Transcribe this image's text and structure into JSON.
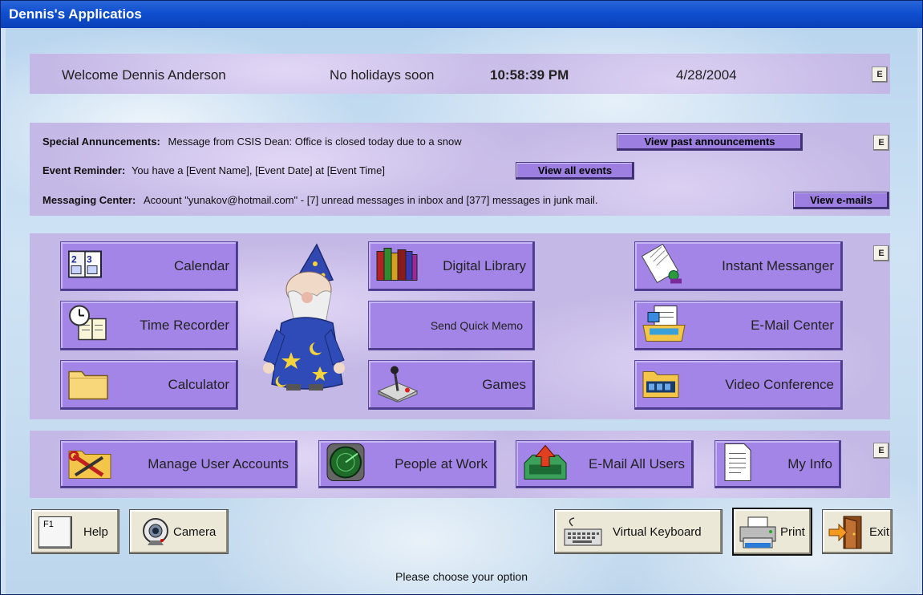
{
  "window": {
    "title": "Dennis's Applicatios"
  },
  "header": {
    "welcome": "Welcome Dennis Anderson",
    "holidays": "No holidays soon",
    "time": "10:58:39 PM",
    "date": "4/28/2004",
    "edit_label": "E"
  },
  "announcements": {
    "special_label": "Special Annuncements:",
    "special_text": "Message from CSIS Dean: Office is closed today due to a snow",
    "special_button": "View past announcements",
    "event_label": "Event Reminder:",
    "event_text": "You have a [Event Name], [Event Date] at [Event Time]",
    "event_button": "View all events",
    "messaging_label": "Messaging Center:",
    "messaging_text": "Acoount \"yunakov@hotmail.com\" - [7] unread messages in inbox and [377] messages in junk mail.",
    "messaging_button": "View e-mails",
    "edit_label": "E"
  },
  "apps": {
    "edit_label": "E",
    "calendar": "Calendar",
    "time_recorder": "Time Recorder",
    "calculator": "Calculator",
    "digital_library": "Digital Library",
    "send_quick_memo": "Send Quick Memo",
    "games": "Games",
    "instant_messanger": "Instant Messanger",
    "email_center": "E-Mail Center",
    "video_conference": "Video Conference"
  },
  "admin": {
    "edit_label": "E",
    "manage_users": "Manage User Accounts",
    "people_at_work": "People at Work",
    "email_all_users": "E-Mail All Users",
    "my_info": "My Info"
  },
  "toolbar": {
    "help": "Help",
    "help_key": "F1",
    "camera": "Camera",
    "virtual_keyboard": "Virtual Keyboard",
    "print": "Print",
    "exit": "Exit"
  },
  "status": {
    "text": "Please choose your option"
  },
  "icons": {
    "calendar": "calendar-icon",
    "time_recorder": "clock-book-icon",
    "calculator": "folder-icon",
    "digital_library": "books-icon",
    "games": "joystick-icon",
    "instant_messanger": "messenger-icon",
    "email_center": "mail-tray-icon",
    "video_conference": "film-folder-icon",
    "manage_users": "tools-folder-icon",
    "people_at_work": "radar-icon",
    "email_all_users": "outbox-icon",
    "my_info": "document-icon",
    "help": "f1-key-icon",
    "camera": "webcam-icon",
    "virtual_keyboard": "keyboard-icon",
    "print": "printer-icon",
    "exit": "exit-door-icon",
    "mascot": "wizard-mascot"
  },
  "colors": {
    "titlebar": "#0f4fcf",
    "panel": "#c4b8e6",
    "app_button": "#a285e6",
    "view_button": "#9c7fe0"
  }
}
